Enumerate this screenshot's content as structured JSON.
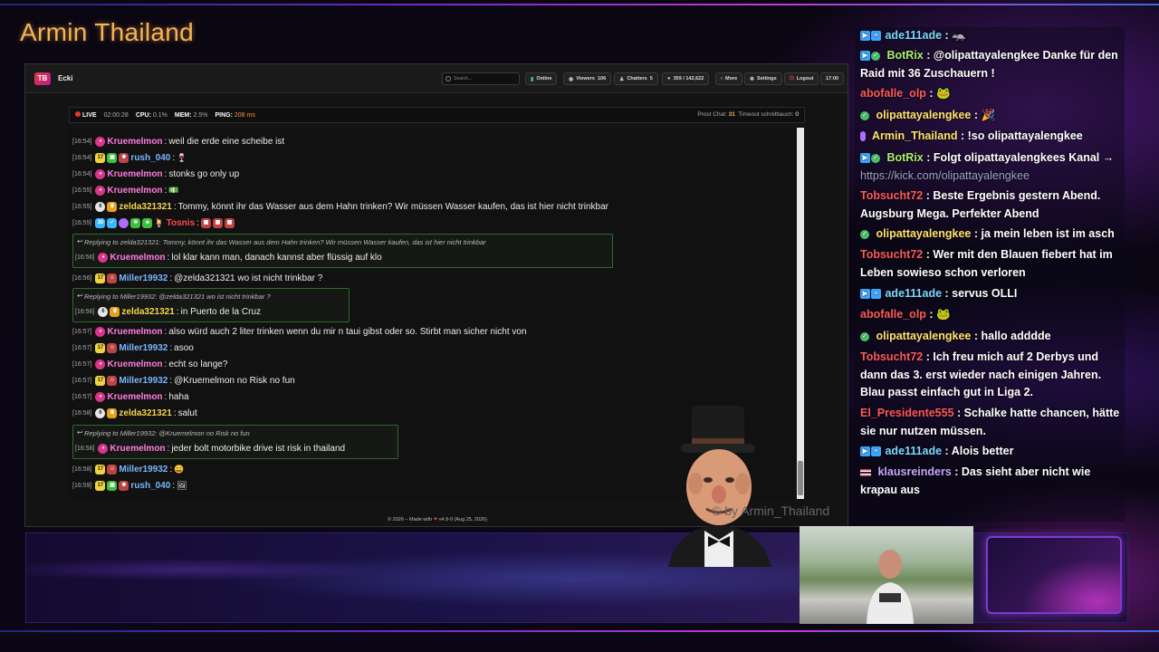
{
  "stream_title": "Armin Thailand",
  "watermark": "© by Armin_Thailand",
  "app": {
    "logo": "TB",
    "title": "Ecki",
    "search_placeholder": "Search...",
    "buttons": {
      "online": "Online",
      "viewers_label": "Viewers",
      "viewers_count": "106",
      "chatters_label": "Chatters",
      "chatters_count": "5",
      "messages": "359 / 142,622",
      "more": "More",
      "settings": "Settings",
      "logout": "Logout",
      "clock": "17:00"
    },
    "status": {
      "live": "LIVE",
      "uptime": "02:00:28",
      "cpu_label": "CPU:",
      "cpu": "0.1%",
      "mem_label": "MEM:",
      "mem": "2.5%",
      "ping_label": "PING:",
      "ping": "208 ms",
      "prost_label": "Prost Chat:",
      "prost_value": "31",
      "timeout_label": "Timeout schnittlauch:",
      "timeout_value": "0"
    },
    "footer": {
      "prefix": "© 2026 – Made with",
      "heart": "❤",
      "suffix": "v4.9-9 (Aug 25, 2026)"
    }
  },
  "chat": [
    {
      "time": "[16:54]",
      "user": "Kruemelmon",
      "text": "weil die erde eine scheibe ist"
    },
    {
      "time": "[16:54]",
      "user": "rush_040",
      "text": ""
    },
    {
      "time": "[16:54]",
      "user": "Kruemelmon",
      "text": "stonks go only up"
    },
    {
      "time": "[16:55]",
      "user": "Kruemelmon",
      "text": ""
    },
    {
      "time": "[16:55]",
      "user": "zelda321321",
      "text": "Tommy, könnt ihr das Wasser aus dem Hahn trinken? Wir müssen Wasser kaufen, das ist hier nicht trinkbar"
    },
    {
      "time": "[16:55]",
      "user": "Tosnis",
      "text": ""
    },
    {
      "reply_to": "Replying to zelda321321: Tommy, könnt ihr das Wasser aus dem Hahn trinken? Wir müssen Wasser kaufen, das ist hier nicht trinkbar",
      "time": "[16:56]",
      "user": "Kruemelmon",
      "text": "lol klar kann man, danach kannst aber flüssig auf klo"
    },
    {
      "time": "[16:56]",
      "user": "Miller19932",
      "text": "@zelda321321 wo ist nicht trinkbar ?"
    },
    {
      "reply_to": "Replying to Miller19932: @zelda321321 wo ist nicht trinkbar ?",
      "time": "[16:56]",
      "user": "zelda321321",
      "text": "in Puerto de la Cruz"
    },
    {
      "time": "[16:57]",
      "user": "Kruemelmon",
      "text": "also würd auch 2 liter trinken wenn du mir n taui gibst oder so. Stirbt man sicher nicht von"
    },
    {
      "time": "[16:57]",
      "user": "Miller19932",
      "text": "asoo"
    },
    {
      "time": "[16:57]",
      "user": "Kruemelmon",
      "text": "echt so lange?"
    },
    {
      "time": "[16:57]",
      "user": "Miller19932",
      "text": "@Kruemelmon no Risk no fun"
    },
    {
      "time": "[16:57]",
      "user": "Kruemelmon",
      "text": "haha"
    },
    {
      "time": "[16:58]",
      "user": "zelda321321",
      "text": "salut"
    },
    {
      "reply_to": "Replying to Miller19932: @Kruemelmon no Risk no fun",
      "time": "[16:58]",
      "user": "Kruemelmon",
      "text": "jeder bolt motorbike drive ist risk in thailand"
    },
    {
      "time": "[16:58]",
      "user": "Miller19932",
      "text": ""
    },
    {
      "time": "[16:59]",
      "user": "rush_040",
      "text": ""
    }
  ],
  "right_chat": [
    {
      "user": "ade111ade",
      "text": ""
    },
    {
      "user": "BotRix",
      "text": "@olipattayalengkee Danke für den Raid mit 36 Zuschauern !"
    },
    {
      "user": "abofalle_olp",
      "text": ""
    },
    {
      "user": "olipattayalengkee",
      "text": ""
    },
    {
      "user": "Armin_Thailand",
      "text": "!so olipattayalengkee"
    },
    {
      "user": "BotRix",
      "text": "Folgt olipattayalengkees Kanal →",
      "link": "https://kick.com/olipattayalengkee"
    },
    {
      "user": "Tobsucht72",
      "text": "Beste Ergebnis gestern Abend. Augsburg Mega. Perfekter Abend"
    },
    {
      "user": "olipattayalengkee",
      "text": "ja mein leben ist im asch"
    },
    {
      "user": "Tobsucht72",
      "text": "Wer mit den Blauen fiebert hat im Leben sowieso schon verloren"
    },
    {
      "user": "ade111ade",
      "text": "servus OLLI"
    },
    {
      "user": "abofalle_olp",
      "text": ""
    },
    {
      "user": "olipattayalengkee",
      "text": "hallo adddde"
    },
    {
      "user": "Tobsucht72",
      "text": "Ich freu mich auf 2 Derbys und dann das 3. erst wieder nach einigen Jahren. Blau passt einfach gut in Liga 2."
    },
    {
      "user": "El_Presidente555",
      "text": "Schalke hatte chancen, hätte sie nur nutzen müssen."
    },
    {
      "user": "ade111ade",
      "text": "Alois better"
    },
    {
      "user": "klausreinders",
      "text": "Das sieht aber nicht wie krapau aus"
    }
  ],
  "colors": {
    "accent_title": "#f4b456",
    "ping": "#ff8a3d",
    "reply_border": "#2d6b2d"
  }
}
